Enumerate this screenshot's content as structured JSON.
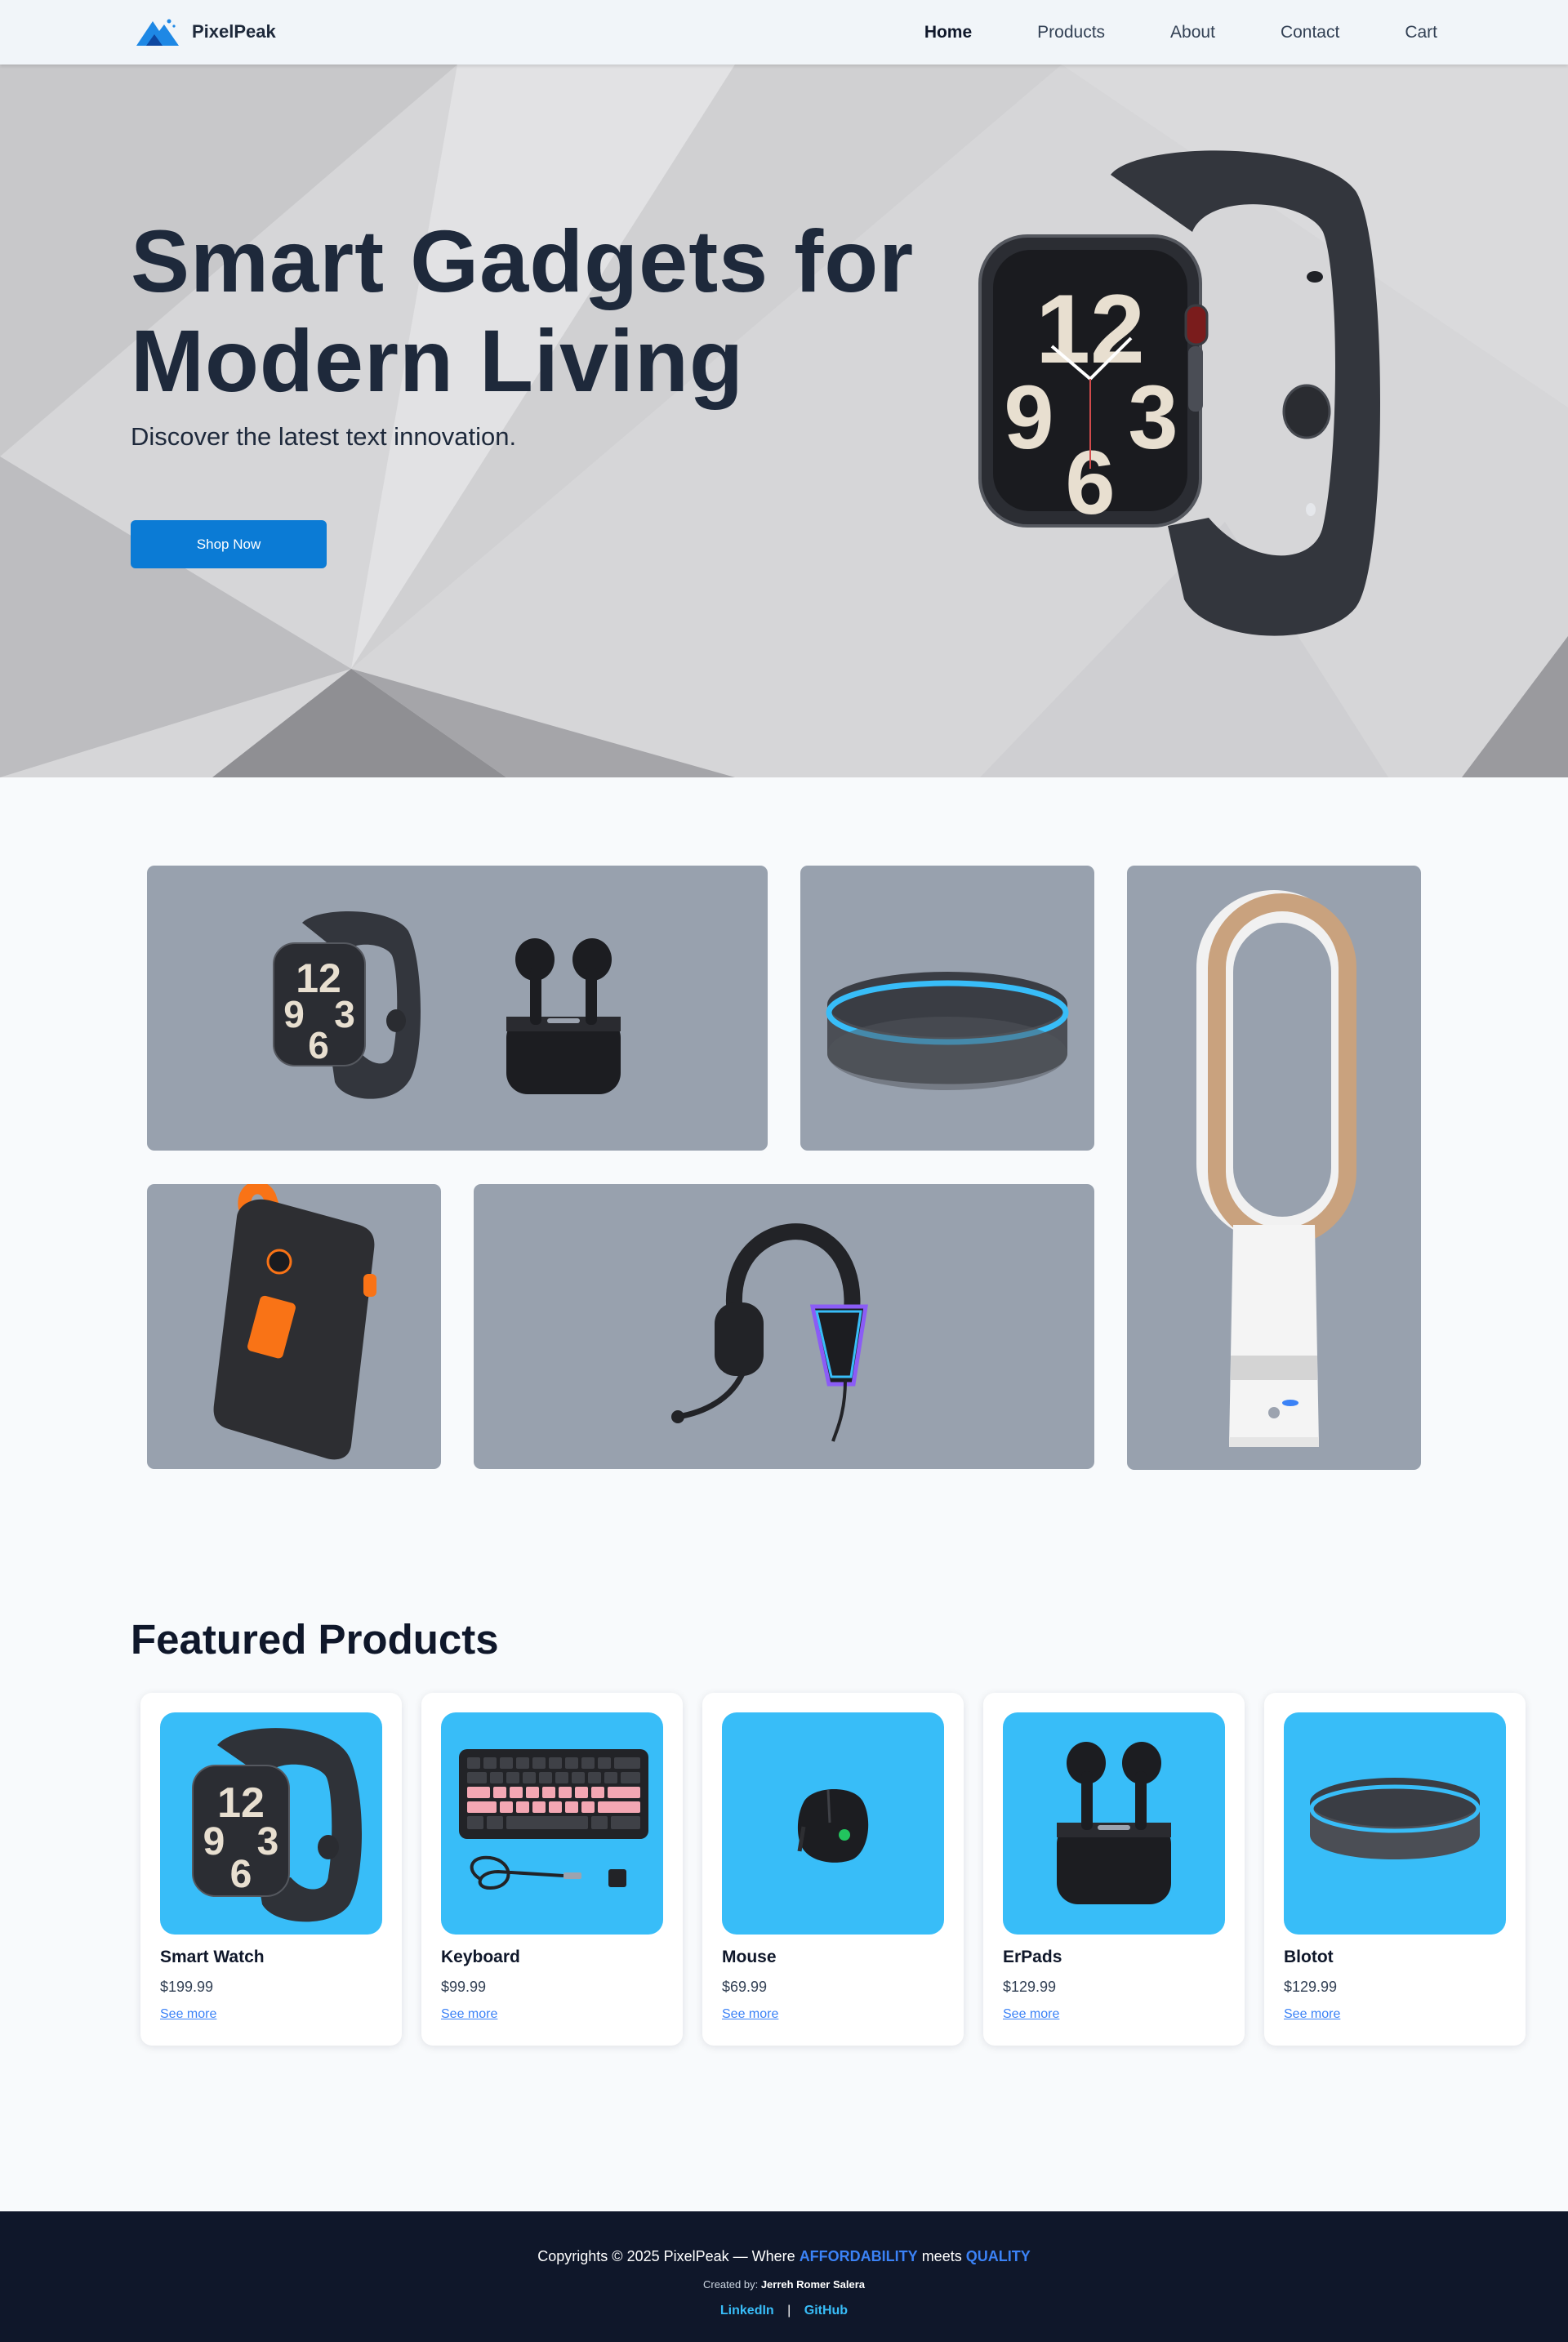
{
  "nav": {
    "brand": "PixelPeak",
    "links": [
      {
        "label": "Home"
      },
      {
        "label": "Products"
      },
      {
        "label": "About"
      },
      {
        "label": "Contact"
      },
      {
        "label": "Cart"
      }
    ]
  },
  "hero": {
    "title_line1": "Smart Gadgets for",
    "title_line2": "Modern Living",
    "subtitle": "Discover the latest text innovation.",
    "button": "Shop Now"
  },
  "featured": {
    "title": "Featured Products",
    "products": [
      {
        "name": "Smart Watch",
        "price": "$199.99",
        "link": "See more",
        "icon": "smartwatch-icon"
      },
      {
        "name": "Keyboard",
        "price": "$99.99",
        "link": "See more",
        "icon": "keyboard-icon"
      },
      {
        "name": "Mouse",
        "price": "$69.99",
        "link": "See more",
        "icon": "mouse-icon"
      },
      {
        "name": "ErPads",
        "price": "$129.99",
        "link": "See more",
        "icon": "earbuds-icon"
      },
      {
        "name": "Blotot",
        "price": "$129.99",
        "link": "See more",
        "icon": "smart-speaker-icon"
      }
    ]
  },
  "footer": {
    "copyright_prefix": "Copyrights © 2025 PixelPeak — Where",
    "word1": "AFFORDABILITY",
    "meets": "meets",
    "word2": "QUALITY",
    "created_label": "Created by:",
    "author": "Jerreh Romer Salera",
    "links": [
      {
        "label": "LinkedIn"
      },
      {
        "label": "GitHub"
      }
    ],
    "separator": "|"
  },
  "colors": {
    "accent": "#0b7bd5",
    "card_bg": "#38bdf8",
    "tile_bg": "#98a1ae",
    "footer_bg": "#0f172a",
    "link": "#3b82f6"
  }
}
